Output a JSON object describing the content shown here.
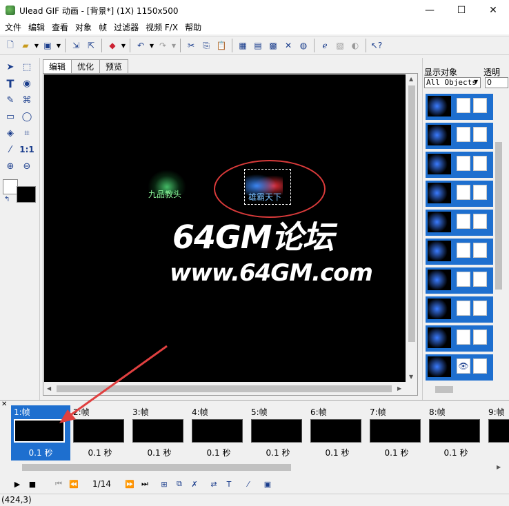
{
  "window": {
    "title": "Ulead GIF 动画 - [背景*] (1X) 1150x500",
    "minimize_glyph": "—",
    "maximize_glyph": "☐",
    "close_glyph": "✕"
  },
  "menu": [
    "文件",
    "编辑",
    "查看",
    "对象",
    "帧",
    "过滤器",
    "视频 F/X",
    "帮助"
  ],
  "tabs": [
    "编辑",
    "优化",
    "预览"
  ],
  "canvas": {
    "text_left": "九品教头",
    "text_right": "雄霸天下",
    "watermark_line1": "64GM论坛",
    "watermark_line2": "www.64GM.com",
    "annotation_color": "#d93a3a"
  },
  "tools": {
    "zoom_label": "1:1"
  },
  "objects_panel": {
    "display_label": "显示对象",
    "transparency_label": "透明",
    "filter_value": "All Objects",
    "transparency_value": "0",
    "rows": 10,
    "selected_color": "#1e6fcf"
  },
  "frames": [
    {
      "label": "1:帧",
      "delay": "0.1 秒",
      "selected": true
    },
    {
      "label": "2:帧",
      "delay": "0.1 秒"
    },
    {
      "label": "3:帧",
      "delay": "0.1 秒"
    },
    {
      "label": "4:帧",
      "delay": "0.1 秒"
    },
    {
      "label": "5:帧",
      "delay": "0.1 秒"
    },
    {
      "label": "6:帧",
      "delay": "0.1 秒"
    },
    {
      "label": "7:帧",
      "delay": "0.1 秒"
    },
    {
      "label": "8:帧",
      "delay": "0.1 秒"
    },
    {
      "label": "9:帧",
      "delay": ""
    }
  ],
  "playback": {
    "frame_counter": "1/14"
  },
  "status": {
    "coords": "(424,3)"
  }
}
